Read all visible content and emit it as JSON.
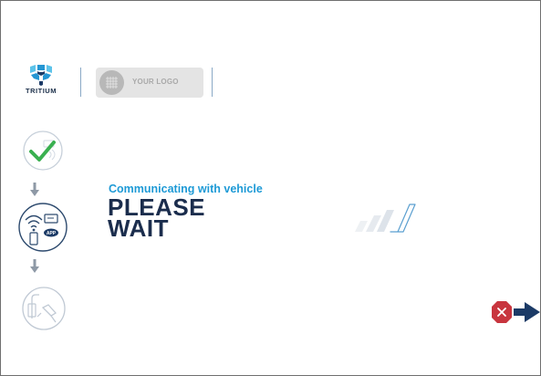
{
  "brand": {
    "name": "TRITIUM",
    "icon": "tritium-logo-icon",
    "colors": {
      "light": "#5cc3ea",
      "mid": "#2496d3",
      "dark": "#1b3a66"
    }
  },
  "partner_logo": {
    "label": "YOUR LOGO",
    "icon": "logo-placeholder-icon"
  },
  "steps": [
    {
      "name": "authorize",
      "state": "complete",
      "icon": "checkmark-circle-icon"
    },
    {
      "name": "authenticate",
      "state": "inactive",
      "icon": "rfid-app-circle-icon",
      "badge": "APP"
    },
    {
      "name": "plug-in",
      "state": "inactive",
      "icon": "plug-connector-circle-icon"
    }
  ],
  "status": {
    "line": "Communicating with vehicle",
    "headline_1": "PLEASE",
    "headline_2": "WAIT"
  },
  "progress": {
    "icon": "progress-slashes-icon",
    "segments": 4,
    "active_segment": 4
  },
  "cancel": {
    "icon": "cancel-exit-icon",
    "colors": {
      "stop": "#c8353e",
      "arrow": "#1b3a66"
    }
  },
  "colors": {
    "accent": "#1e9ad6",
    "headline": "#1b2d4d",
    "success": "#3ab050",
    "inactive": "#c0c9d4"
  }
}
